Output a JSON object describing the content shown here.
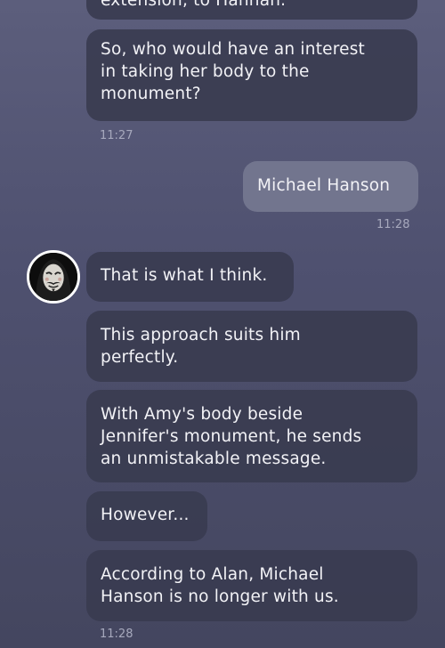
{
  "chat": {
    "messages": [
      {
        "id": "m0",
        "sender": "incoming",
        "text": "extension, to Hannah."
      },
      {
        "id": "m1",
        "sender": "incoming",
        "text": "So, who would have an interest\nin taking her body to the\nmonument?"
      },
      {
        "id": "m2",
        "sender": "outgoing",
        "text": "Michael Hanson"
      },
      {
        "id": "m3",
        "sender": "incoming",
        "text": "That is what I think."
      },
      {
        "id": "m4",
        "sender": "incoming",
        "text": "This approach suits him\nperfectly."
      },
      {
        "id": "m5",
        "sender": "incoming",
        "text": "With Amy's body beside\nJennifer's monument, he sends\nan unmistakable message."
      },
      {
        "id": "m6",
        "sender": "incoming",
        "text": "However..."
      },
      {
        "id": "m7",
        "sender": "incoming",
        "text": "According to Alan, Michael\nHanson is no longer with us."
      }
    ],
    "timestamps": {
      "t1": "11:27",
      "t2": "11:28",
      "t3": "11:28"
    },
    "avatar_icon": "masked-figure-avatar"
  },
  "colors": {
    "incoming_bubble": "#3a3c50",
    "outgoing_bubble": "#767991",
    "timestamp": "#a7a9bd",
    "background_top": "#5c5e7c",
    "background_bottom": "#44465f"
  }
}
